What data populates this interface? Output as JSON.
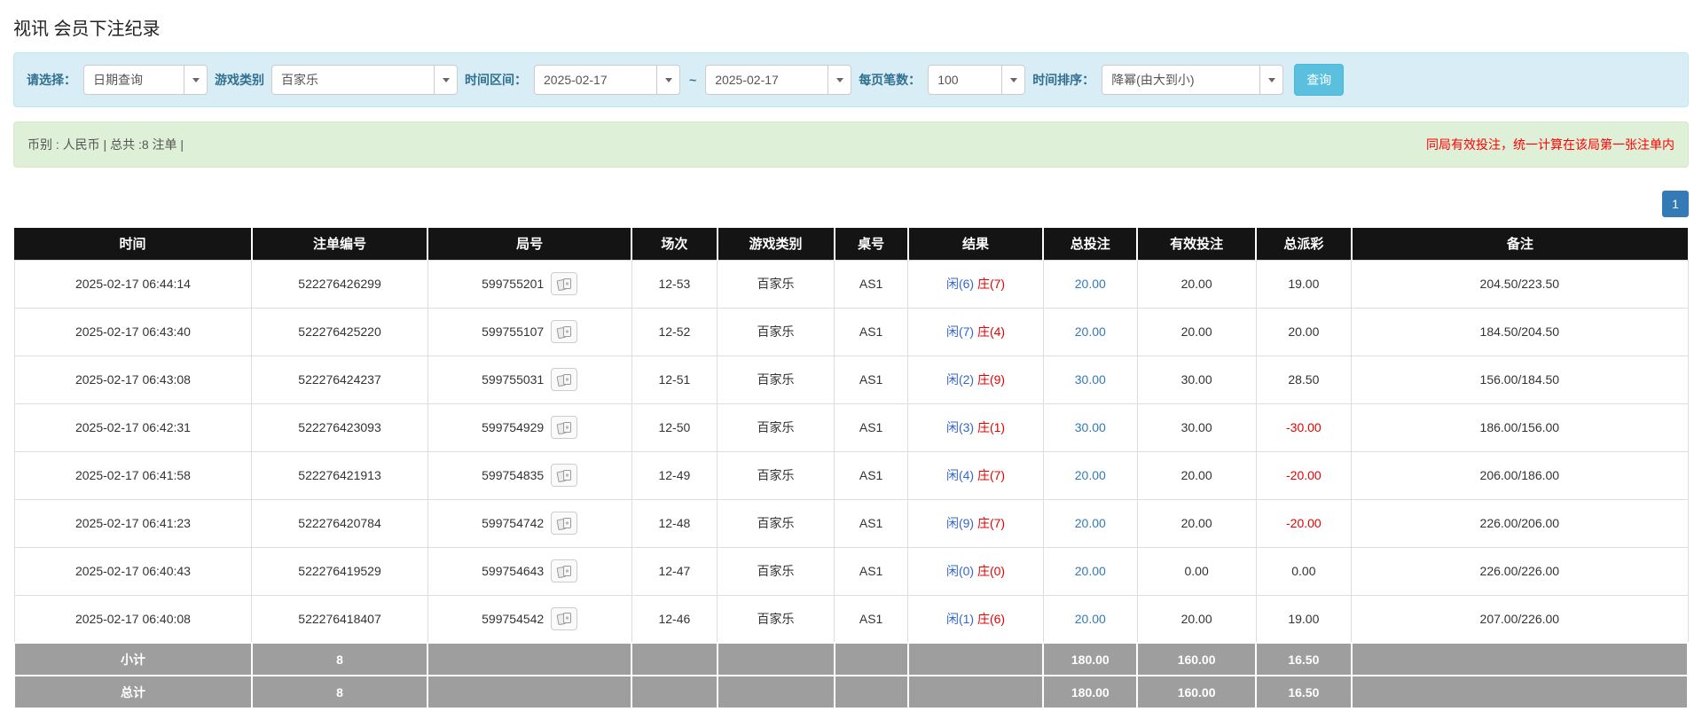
{
  "page": {
    "title": "视讯 会员下注纪录"
  },
  "colors": {
    "accent_blue": "#337ab7",
    "player_blue": "#3366cc",
    "banker_red": "#e60000",
    "negative_red": "#e60000",
    "filter_bg": "#d9edf7",
    "summary_bg": "#dff0d8",
    "header_bg": "#141414",
    "footer_bg": "#9e9e9e",
    "search_button_bg": "#5bc0de"
  },
  "filters": {
    "select_label": "请选择：",
    "select_value": "日期查询",
    "game_type_label": "游戏类别",
    "game_type_value": "百家乐",
    "date_range_label": "时间区间：",
    "date_from": "2025-02-17",
    "tilde": "~",
    "date_to": "2025-02-17",
    "page_size_label": "每页笔数：",
    "page_size_value": "100",
    "sort_label": "时间排序：",
    "sort_value": "降幂(由大到小)",
    "search_button": "查询"
  },
  "summary": {
    "left": "币别 : 人民币 | 总共 :8 注单 |",
    "right": "同局有效投注，统一计算在该局第一张注单内"
  },
  "pagination": {
    "current": "1"
  },
  "table": {
    "headers": [
      "时间",
      "注单编号",
      "局号",
      "场次",
      "游戏类别",
      "桌号",
      "结果",
      "总投注",
      "有效投注",
      "总派彩",
      "备注"
    ],
    "rows": [
      {
        "time": "2025-02-17 06:44:14",
        "bet_id": "522276426299",
        "round_id": "599755201",
        "session": "12-53",
        "game": "百家乐",
        "table_no": "AS1",
        "result_player": "闲(6)",
        "result_banker": "庄(7)",
        "total_bet": "20.00",
        "valid_bet": "20.00",
        "payout": "19.00",
        "note": "204.50/223.50"
      },
      {
        "time": "2025-02-17 06:43:40",
        "bet_id": "522276425220",
        "round_id": "599755107",
        "session": "12-52",
        "game": "百家乐",
        "table_no": "AS1",
        "result_player": "闲(7)",
        "result_banker": "庄(4)",
        "total_bet": "20.00",
        "valid_bet": "20.00",
        "payout": "20.00",
        "note": "184.50/204.50"
      },
      {
        "time": "2025-02-17 06:43:08",
        "bet_id": "522276424237",
        "round_id": "599755031",
        "session": "12-51",
        "game": "百家乐",
        "table_no": "AS1",
        "result_player": "闲(2)",
        "result_banker": "庄(9)",
        "total_bet": "30.00",
        "valid_bet": "30.00",
        "payout": "28.50",
        "note": "156.00/184.50"
      },
      {
        "time": "2025-02-17 06:42:31",
        "bet_id": "522276423093",
        "round_id": "599754929",
        "session": "12-50",
        "game": "百家乐",
        "table_no": "AS1",
        "result_player": "闲(3)",
        "result_banker": "庄(1)",
        "total_bet": "30.00",
        "valid_bet": "30.00",
        "payout": "-30.00",
        "note": "186.00/156.00"
      },
      {
        "time": "2025-02-17 06:41:58",
        "bet_id": "522276421913",
        "round_id": "599754835",
        "session": "12-49",
        "game": "百家乐",
        "table_no": "AS1",
        "result_player": "闲(4)",
        "result_banker": "庄(7)",
        "total_bet": "20.00",
        "valid_bet": "20.00",
        "payout": "-20.00",
        "note": "206.00/186.00"
      },
      {
        "time": "2025-02-17 06:41:23",
        "bet_id": "522276420784",
        "round_id": "599754742",
        "session": "12-48",
        "game": "百家乐",
        "table_no": "AS1",
        "result_player": "闲(9)",
        "result_banker": "庄(7)",
        "total_bet": "20.00",
        "valid_bet": "20.00",
        "payout": "-20.00",
        "note": "226.00/206.00"
      },
      {
        "time": "2025-02-17 06:40:43",
        "bet_id": "522276419529",
        "round_id": "599754643",
        "session": "12-47",
        "game": "百家乐",
        "table_no": "AS1",
        "result_player": "闲(0)",
        "result_banker": "庄(0)",
        "total_bet": "20.00",
        "valid_bet": "0.00",
        "payout": "0.00",
        "note": "226.00/226.00"
      },
      {
        "time": "2025-02-17 06:40:08",
        "bet_id": "522276418407",
        "round_id": "599754542",
        "session": "12-46",
        "game": "百家乐",
        "table_no": "AS1",
        "result_player": "闲(1)",
        "result_banker": "庄(6)",
        "total_bet": "20.00",
        "valid_bet": "20.00",
        "payout": "19.00",
        "note": "207.00/226.00"
      }
    ],
    "subtotal": {
      "label": "小计",
      "count": "8",
      "total_bet": "180.00",
      "valid_bet": "160.00",
      "payout": "16.50"
    },
    "total": {
      "label": "总计",
      "count": "8",
      "total_bet": "180.00",
      "valid_bet": "160.00",
      "payout": "16.50"
    }
  }
}
